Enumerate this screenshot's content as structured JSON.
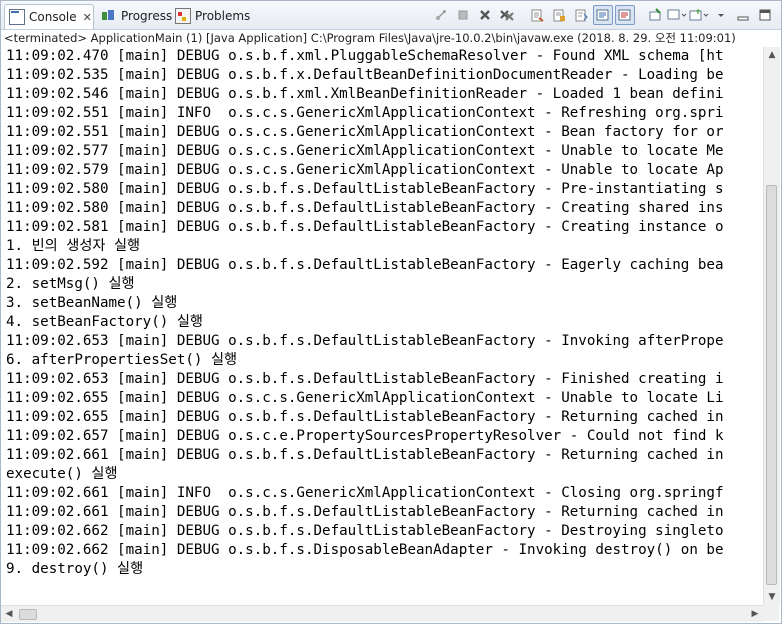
{
  "tabs": [
    {
      "label": "Console",
      "close": "✕",
      "icon": "console-icon",
      "active": true
    },
    {
      "label": "Progress",
      "icon": "progress-icon"
    },
    {
      "label": "Problems",
      "icon": "problems-icon"
    }
  ],
  "toolbar": {
    "icons": [
      "remove-launch-icon",
      "terminate-icon",
      "remove-launch-x-icon",
      "remove-all-terminated-icon",
      "clear-console-icon",
      "scroll-lock-icon",
      "word-wrap-icon",
      "show-on-stdout-icon",
      "show-on-stderr-icon",
      "pin-console-icon",
      "display-selected-console-icon",
      "open-console-icon",
      "view-menu-icon",
      "minimize-icon",
      "maximize-icon"
    ]
  },
  "status": "<terminated> ApplicationMain (1) [Java Application] C:\\Program Files\\Java\\jre-10.0.2\\bin\\javaw.exe (2018. 8. 29. 오전 11:09:01)",
  "lines": [
    "11:09:02.470 [main] DEBUG o.s.b.f.xml.PluggableSchemaResolver - Found XML schema [ht",
    "11:09:02.535 [main] DEBUG o.s.b.f.x.DefaultBeanDefinitionDocumentReader - Loading be",
    "11:09:02.546 [main] DEBUG o.s.b.f.xml.XmlBeanDefinitionReader - Loaded 1 bean defini",
    "11:09:02.551 [main] INFO  o.s.c.s.GenericXmlApplicationContext - Refreshing org.spri",
    "11:09:02.551 [main] DEBUG o.s.c.s.GenericXmlApplicationContext - Bean factory for or",
    "11:09:02.577 [main] DEBUG o.s.c.s.GenericXmlApplicationContext - Unable to locate Me",
    "11:09:02.579 [main] DEBUG o.s.c.s.GenericXmlApplicationContext - Unable to locate Ap",
    "11:09:02.580 [main] DEBUG o.s.b.f.s.DefaultListableBeanFactory - Pre-instantiating s",
    "11:09:02.580 [main] DEBUG o.s.b.f.s.DefaultListableBeanFactory - Creating shared ins",
    "11:09:02.581 [main] DEBUG o.s.b.f.s.DefaultListableBeanFactory - Creating instance o",
    "1. 빈의 생성자 실행",
    "11:09:02.592 [main] DEBUG o.s.b.f.s.DefaultListableBeanFactory - Eagerly caching bea",
    "2. setMsg() 실행",
    "3. setBeanName() 실행",
    "4. setBeanFactory() 실행",
    "11:09:02.653 [main] DEBUG o.s.b.f.s.DefaultListableBeanFactory - Invoking afterPrope",
    "6. afterPropertiesSet() 실행",
    "11:09:02.653 [main] DEBUG o.s.b.f.s.DefaultListableBeanFactory - Finished creating i",
    "11:09:02.655 [main] DEBUG o.s.c.s.GenericXmlApplicationContext - Unable to locate Li",
    "11:09:02.655 [main] DEBUG o.s.b.f.s.DefaultListableBeanFactory - Returning cached in",
    "11:09:02.657 [main] DEBUG o.s.c.e.PropertySourcesPropertyResolver - Could not find k",
    "11:09:02.661 [main] DEBUG o.s.b.f.s.DefaultListableBeanFactory - Returning cached in",
    "execute() 실행",
    "11:09:02.661 [main] INFO  o.s.c.s.GenericXmlApplicationContext - Closing org.springf",
    "11:09:02.661 [main] DEBUG o.s.b.f.s.DefaultListableBeanFactory - Returning cached in",
    "11:09:02.662 [main] DEBUG o.s.b.f.s.DefaultListableBeanFactory - Destroying singleto",
    "11:09:02.662 [main] DEBUG o.s.b.f.s.DisposableBeanAdapter - Invoking destroy() on be",
    "9. destroy() 실행"
  ]
}
